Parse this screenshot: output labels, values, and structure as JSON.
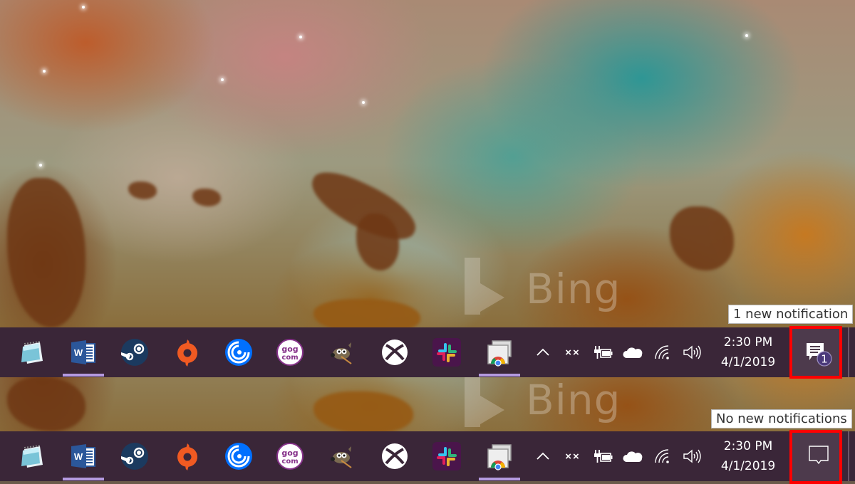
{
  "wallpaper": {
    "watermark": "Bing",
    "description": "Carina nebula"
  },
  "taskbars": [
    {
      "state": "with-notification",
      "apps": [
        {
          "name": "Notepad",
          "icon": "notepad-icon",
          "running": false
        },
        {
          "name": "Microsoft Word",
          "icon": "word-icon",
          "running": true,
          "letter": "W"
        },
        {
          "name": "Steam",
          "icon": "steam-icon",
          "running": false
        },
        {
          "name": "Origin",
          "icon": "origin-icon",
          "running": false
        },
        {
          "name": "Uplay",
          "icon": "uplay-icon",
          "running": false
        },
        {
          "name": "GOG Galaxy",
          "icon": "gog-icon",
          "running": false,
          "text_top": "gog",
          "text_bottom": "com"
        },
        {
          "name": "GIMP",
          "icon": "gimp-icon",
          "running": false
        },
        {
          "name": "Xbox",
          "icon": "xbox-icon",
          "running": false
        },
        {
          "name": "Slack",
          "icon": "slack-icon",
          "running": false
        },
        {
          "name": "Chrome Remote Desktop",
          "icon": "chrome-remote-desktop-icon",
          "running": true
        }
      ],
      "tray": [
        {
          "name": "show-hidden-icons",
          "glyph": "^"
        },
        {
          "name": "input-indicator",
          "glyph": "××"
        },
        {
          "name": "battery-charging",
          "glyph": ""
        },
        {
          "name": "onedrive",
          "glyph": ""
        },
        {
          "name": "wifi",
          "glyph": ""
        },
        {
          "name": "volume",
          "glyph": ""
        }
      ],
      "clock": {
        "time": "2:30 PM",
        "date": "4/1/2019"
      },
      "action_center": {
        "tooltip": "1 new notification",
        "badge": "1",
        "has_notifications": true
      }
    },
    {
      "state": "no-notification",
      "apps": [
        {
          "name": "Notepad",
          "icon": "notepad-icon",
          "running": false
        },
        {
          "name": "Microsoft Word",
          "icon": "word-icon",
          "running": true,
          "letter": "W"
        },
        {
          "name": "Steam",
          "icon": "steam-icon",
          "running": false
        },
        {
          "name": "Origin",
          "icon": "origin-icon",
          "running": false
        },
        {
          "name": "Uplay",
          "icon": "uplay-icon",
          "running": false
        },
        {
          "name": "GOG Galaxy",
          "icon": "gog-icon",
          "running": false,
          "text_top": "gog",
          "text_bottom": "com"
        },
        {
          "name": "GIMP",
          "icon": "gimp-icon",
          "running": false
        },
        {
          "name": "Xbox",
          "icon": "xbox-icon",
          "running": false
        },
        {
          "name": "Slack",
          "icon": "slack-icon",
          "running": false
        },
        {
          "name": "Chrome Remote Desktop",
          "icon": "chrome-remote-desktop-icon",
          "running": true
        }
      ],
      "tray": [
        {
          "name": "show-hidden-icons",
          "glyph": "^"
        },
        {
          "name": "input-indicator",
          "glyph": "××"
        },
        {
          "name": "battery-charging",
          "glyph": ""
        },
        {
          "name": "onedrive",
          "glyph": ""
        },
        {
          "name": "wifi",
          "glyph": ""
        },
        {
          "name": "volume",
          "glyph": ""
        }
      ],
      "clock": {
        "time": "2:30 PM",
        "date": "4/1/2019"
      },
      "action_center": {
        "tooltip": "No new notifications",
        "badge": "",
        "has_notifications": false
      }
    }
  ],
  "colors": {
    "taskbar": "#3a2638",
    "running_indicator": "#b49ae0",
    "highlight_box": "#ff0000",
    "badge": "#4b3a7a"
  }
}
